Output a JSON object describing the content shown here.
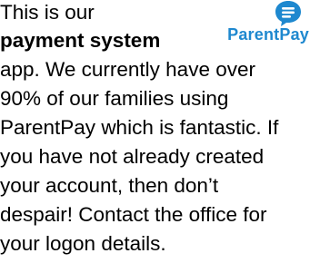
{
  "paragraph": {
    "line1": "This is our",
    "line2": "payment system",
    "line3": "app. We currently have over",
    "line4": "90% of our families using",
    "line5": "ParentPay which is fantastic. If",
    "line6": "you have not already created",
    "line7": "your account, then don’t",
    "line8": "despair! Contact the office for",
    "line9": "your logon details."
  },
  "logo": {
    "text": "ParentPay",
    "icon": "speech-bubble-icon",
    "color": "#1e88cf"
  }
}
